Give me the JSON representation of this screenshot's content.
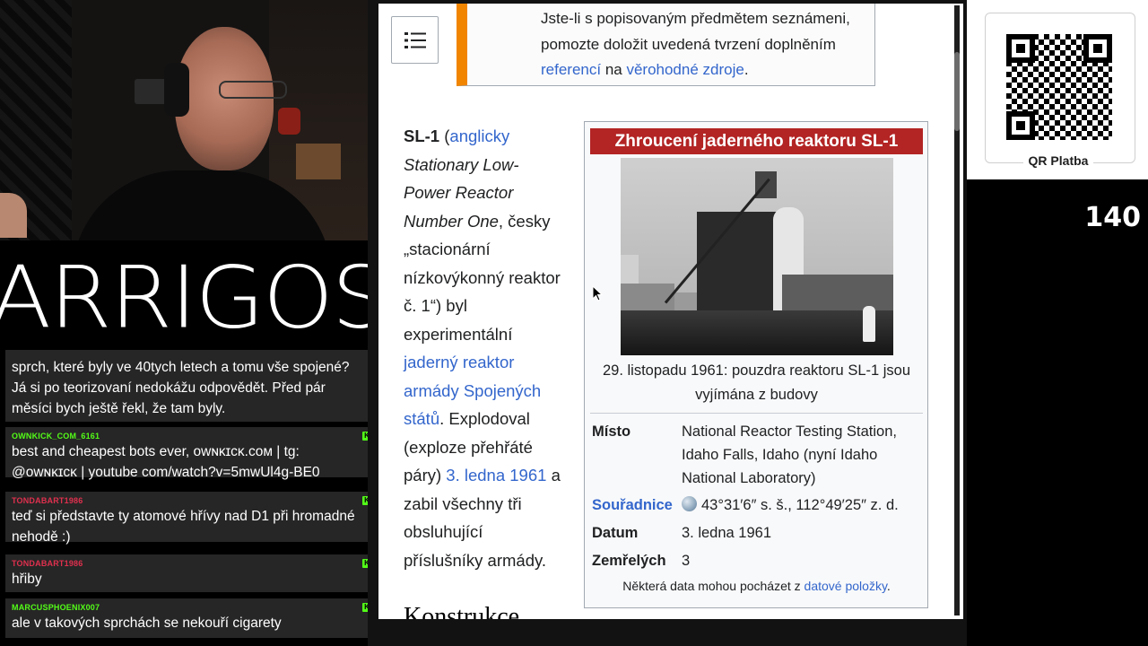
{
  "stream": {
    "viewer_count": "140",
    "logo_text": "ARRIGOS"
  },
  "chat": {
    "messages": [
      {
        "username": "",
        "text": "sprch, které byly ve 40tych letech a tomu vše spojené? Já si po teorizovaní nedokážu odpovědět. Před pár měsíci bych ještě řekl, že tam byly."
      },
      {
        "username": "OWNKICK_COM_6161",
        "text": "best and cheapest bots ever, ᴏwɴᴋɪcᴋ.cᴏᴍ | tg: @ᴏwɴᴋɪcᴋ | youtube com/watch?v=5mwUl4g-BE0",
        "color": "#53fc18"
      },
      {
        "username": "TONDABART1986",
        "text": "teď si představte ty atomové hřívy nad D1 při hromadné nehodě :)",
        "color": "#e0304e"
      },
      {
        "username": "TONDABART1986",
        "text": "hřiby",
        "color": "#e0304e"
      },
      {
        "username": "MARCUSPHOENIX007",
        "text": "ale v takových sprchách se nekouří cigarety",
        "color": "#53fc18"
      }
    ]
  },
  "article": {
    "ambox": {
      "line1": "Jste-li s popisovaným předmětem seznámeni, pomozte doložit uvedená tvrzení doplněním",
      "link1": "referencí",
      "mid": " na ",
      "link2": "věrohodné zdroje",
      "end": "."
    },
    "lead": {
      "bold": "SL-1",
      "p1": " (",
      "lang_link": "anglicky",
      "italic": " Stationary Low-Power Reactor Number One",
      "p2": ", česky „stacionární nízkovýkonný reaktor č. 1“) byl experimentální ",
      "link_reactor": "jaderný reaktor",
      "p3": " ",
      "link_army": "armády Spojených států",
      "p4": ". Explodoval (exploze přehřáté páry) ",
      "link_date": "3. ledna 1961",
      "p5": " a zabil všechny tři obsluhující příslušníky armády."
    },
    "next_heading": "Konstrukce",
    "infobox": {
      "title": "Zhroucení jaderného reaktoru SL-1",
      "caption": "29. listopadu 1961: pouzdra reaktoru SL-1 jsou vyjímána z budovy",
      "rows": [
        {
          "key": "Místo",
          "value": "National Reactor Testing Station, Idaho Falls, Idaho (nyní Idaho National Laboratory)"
        },
        {
          "key": "Souřadnice",
          "value": "43°31′6″ s. š., 112°49′25″ z. d."
        },
        {
          "key": "Datum",
          "value": "3. ledna 1961"
        },
        {
          "key": "Zemřelých",
          "value": "3"
        }
      ],
      "footnote_text": "Některá data mohou pocházet z ",
      "footnote_link": "datové položky",
      "footnote_end": "."
    }
  },
  "qr": {
    "label": "QR Platba"
  },
  "icons": {
    "toc": "list-icon",
    "kick": "kick-logo-icon",
    "globe": "globe-icon"
  },
  "colors": {
    "infobox_title_bg": "#b32424",
    "link": "#3366cc",
    "ambox_border": "#f28500",
    "kick_green": "#53fc18",
    "chat_red": "#e0304e"
  }
}
